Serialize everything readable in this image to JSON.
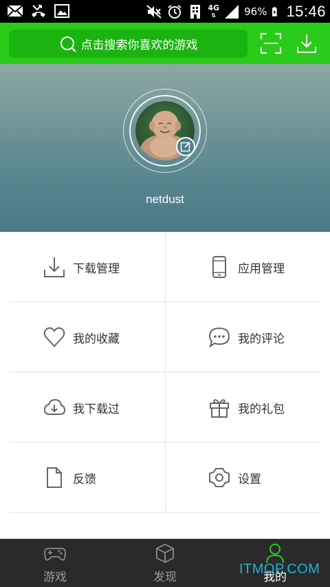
{
  "status_bar": {
    "network_type": "4G",
    "battery_percent": "96%",
    "time": "15:46"
  },
  "header": {
    "search_placeholder": "点击搜索你喜欢的游戏"
  },
  "profile": {
    "username": "netdust"
  },
  "menu": [
    {
      "label": "下载管理",
      "icon": "download-icon"
    },
    {
      "label": "应用管理",
      "icon": "phone-icon"
    },
    {
      "label": "我的收藏",
      "icon": "heart-icon"
    },
    {
      "label": "我的评论",
      "icon": "comment-icon"
    },
    {
      "label": "我下载过",
      "icon": "cloud-download-icon"
    },
    {
      "label": "我的礼包",
      "icon": "gift-icon"
    },
    {
      "label": "反馈",
      "icon": "document-icon"
    },
    {
      "label": "设置",
      "icon": "settings-icon"
    }
  ],
  "bottom_nav": [
    {
      "label": "游戏",
      "icon": "gamepad-icon",
      "active": false
    },
    {
      "label": "发现",
      "icon": "cube-icon",
      "active": false
    },
    {
      "label": "我的",
      "icon": "user-icon",
      "active": true
    }
  ],
  "watermark": "ITMOP.COM",
  "colors": {
    "brand_green": "#2bcb1b",
    "active_tab": "#2bcb1b",
    "inactive_tab": "#9a9a9a"
  }
}
